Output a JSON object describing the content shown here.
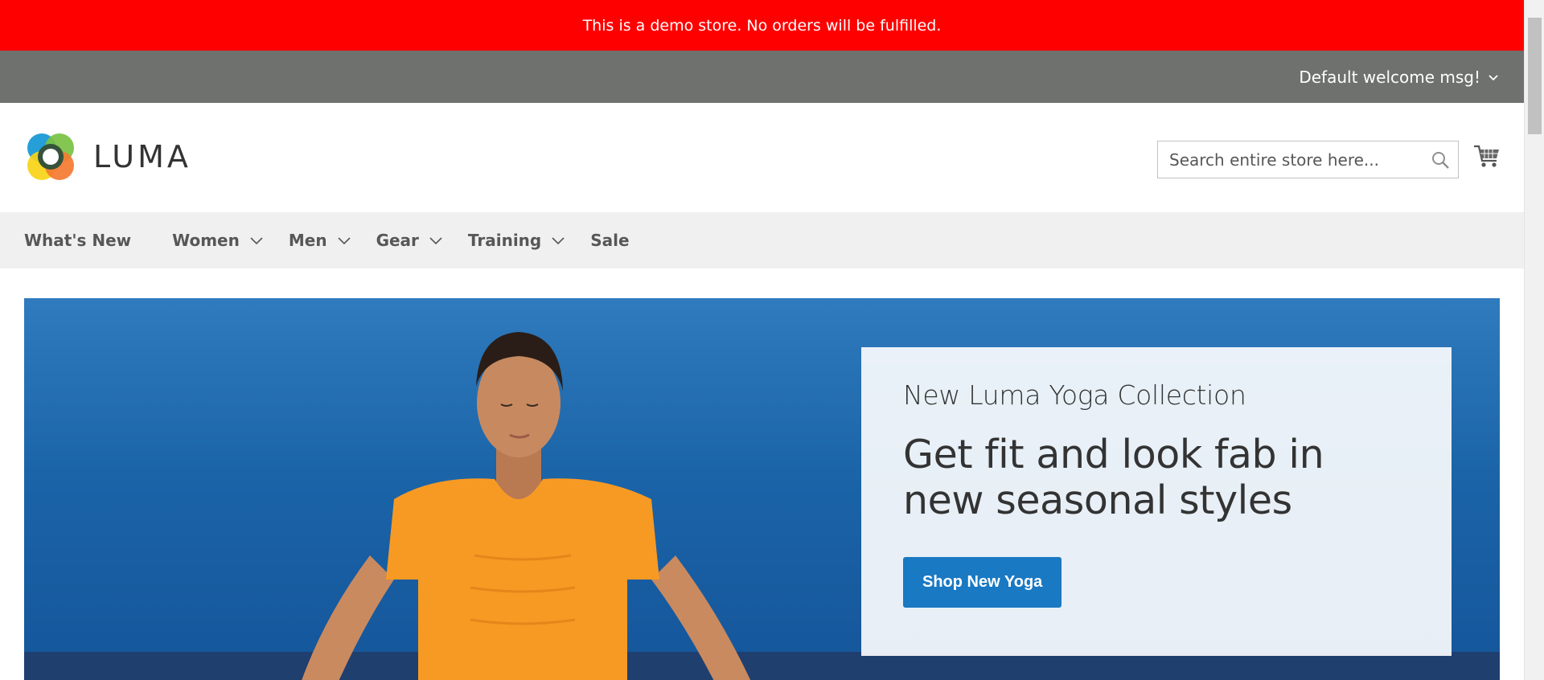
{
  "demo_notice": {
    "text": "This is a demo store. No orders will be fulfilled.",
    "bg": "#ff0000"
  },
  "panel": {
    "welcome_text": "Default welcome msg!",
    "bg": "#6e716e"
  },
  "header": {
    "logo_text": "LUMA",
    "search": {
      "placeholder": "Search entire store here...",
      "value": ""
    },
    "icons": [
      "search-icon",
      "cart-icon"
    ]
  },
  "nav": {
    "items": [
      {
        "label": "What's New",
        "has_dropdown": false
      },
      {
        "label": "Women",
        "has_dropdown": true
      },
      {
        "label": "Men",
        "has_dropdown": true
      },
      {
        "label": "Gear",
        "has_dropdown": true
      },
      {
        "label": "Training",
        "has_dropdown": true
      },
      {
        "label": "Sale",
        "has_dropdown": false
      }
    ]
  },
  "hero": {
    "kicker": "New Luma Yoga Collection",
    "headline": "Get fit and look fab in new seasonal styles",
    "cta_label": "Shop New Yoga",
    "cta_color": "#1979c3"
  }
}
